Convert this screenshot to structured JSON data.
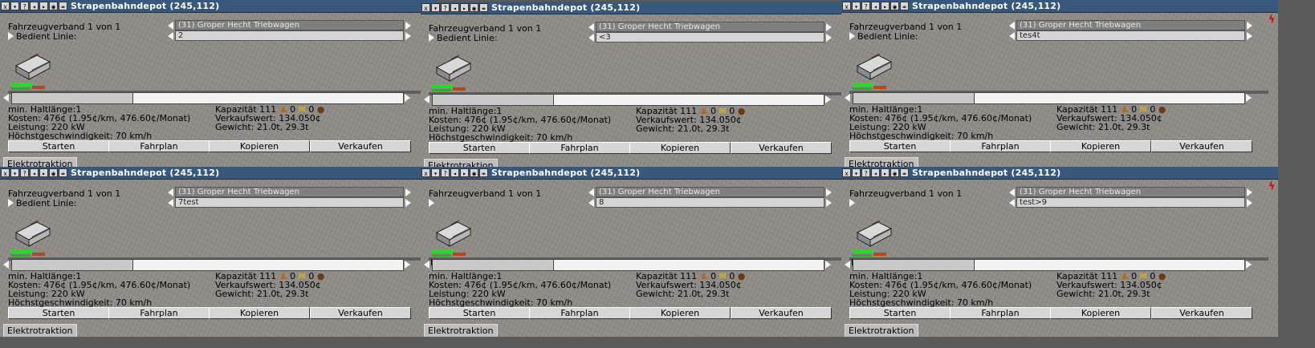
{
  "windows": [
    {
      "title": "Strapenbahndepot  (245,112)",
      "convoy": "Fahrzeugverband 1 von 1",
      "vehicle": "(31) Groper Hecht Triebwagen",
      "line_label": "Bedient Linie:",
      "line_value": "2",
      "overlay_line": "",
      "tab": "Elektrotraktion"
    },
    {
      "title": "Strapenbahndepot  (245,112)",
      "convoy": "Fahrzeugverband 1 von 1",
      "vehicle": "(31) Groper Hecht Triebwagen",
      "line_label": "Bedient Linie:",
      "line_value": "<3",
      "overlay_line": "",
      "tab": "Elektrotraktion"
    },
    {
      "title": "Strapenbahndepot  (245,112)",
      "convoy": "Fahrzeugverband 1 von 1",
      "vehicle": "(31) Groper Hecht Triebwagen",
      "line_label": "Bedient Linie:",
      "line_value": "tes4t",
      "overlay_line": "",
      "tab": "Elektrotraktion"
    },
    {
      "title": "Strapenbahndepot  (245,112)",
      "convoy": "Fahrzeugverband 1 von 1",
      "vehicle": "(31) Groper Hecht Triebwagen",
      "line_label": "Bedient Linie:",
      "line_value": "7test",
      "overlay_line": "",
      "tab": "Elektrotraktion"
    },
    {
      "title": "Strapenbahndepot  (245,112)",
      "convoy": "Fahrzeugverband 1 von 1",
      "vehicle": "(31) Groper Hecht Triebwagen",
      "line_label": "",
      "line_value": "8",
      "overlay_line": "Bedient Linie:",
      "tab": "Elektrotraktion"
    },
    {
      "title": "Strapenbahndepot  (245,112)",
      "convoy": "Fahrzeugverband 1 von 1",
      "vehicle": "(31) Groper Hecht Triebwagen",
      "line_label": "",
      "line_value": "test>9",
      "overlay_line": "Bedient Linie:",
      "tab": "Elektrotraktion"
    }
  ],
  "stats": {
    "min_length": "min. Haltlänge:1",
    "costs": "Kosten: 476¢ (1.95¢/km, 476.60¢/Monat)",
    "power": "Leistung:  220 kW",
    "speed": "Höchstgeschwindigkeit: 70 km/h",
    "capacity": "Kapazität 111",
    "cap_zero_a": "0",
    "cap_zero_b": "0",
    "value": "Verkaufswert: 134.050¢",
    "weight": "Gewicht: 21.0t, 29.3t"
  },
  "buttons": {
    "start": "Starten",
    "schedule": "Fahrplan",
    "copy": "Kopieren",
    "sell": "Verkaufen"
  },
  "titlebar_glyphs": {
    "close": "x",
    "menu": "▾",
    "help": "?",
    "prev": "◂",
    "next": "▸",
    "eye": "◉",
    "pin": "⇹"
  },
  "colors": {
    "titlebar": "#37587a",
    "body": "#8e8a86",
    "button": "#d6d6d6"
  }
}
